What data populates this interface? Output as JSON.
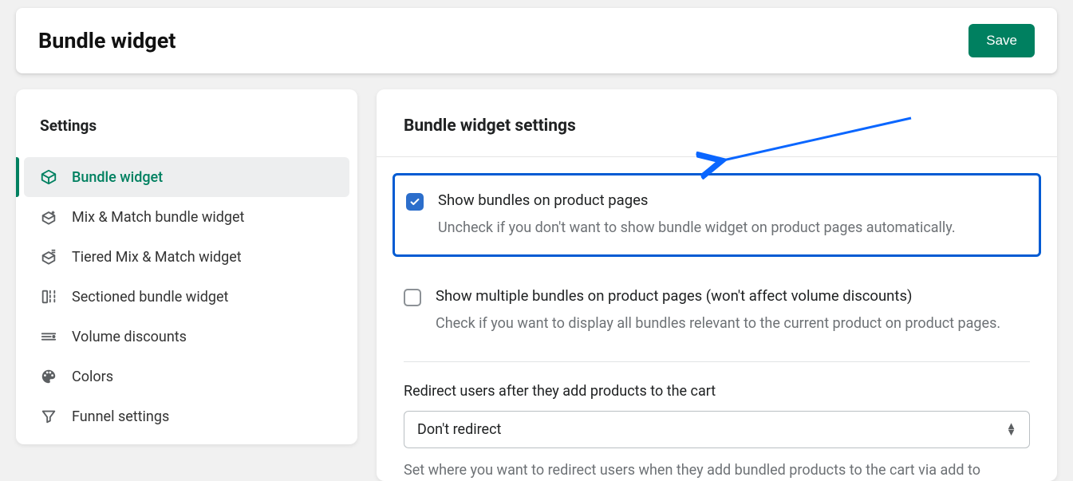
{
  "header": {
    "title": "Bundle widget",
    "save_label": "Save"
  },
  "sidebar": {
    "heading": "Settings",
    "items": [
      {
        "label": "Bundle widget",
        "icon": "box-icon",
        "active": true
      },
      {
        "label": "Mix & Match bundle widget",
        "icon": "box-plus-icon",
        "active": false
      },
      {
        "label": "Tiered Mix & Match widget",
        "icon": "box-tier-icon",
        "active": false
      },
      {
        "label": "Sectioned bundle widget",
        "icon": "sections-icon",
        "active": false
      },
      {
        "label": "Volume discounts",
        "icon": "discount-icon",
        "active": false
      },
      {
        "label": "Colors",
        "icon": "palette-icon",
        "active": false
      },
      {
        "label": "Funnel settings",
        "icon": "funnel-icon",
        "active": false
      }
    ]
  },
  "main": {
    "heading": "Bundle widget settings",
    "setting1": {
      "title": "Show bundles on product pages",
      "desc": "Uncheck if you don't want to show bundle widget on product pages automatically.",
      "checked": true
    },
    "setting2": {
      "title": "Show multiple bundles on product pages (won't affect volume discounts)",
      "desc": "Check if you want to display all bundles relevant to the current product on product pages.",
      "checked": false
    },
    "redirect": {
      "label": "Redirect users after they add products to the cart",
      "selected": "Don't redirect",
      "help": "Set where you want to redirect users when they add bundled products to the cart via add to"
    }
  },
  "colors": {
    "accent": "#008060",
    "highlight_border": "#005bd3"
  }
}
